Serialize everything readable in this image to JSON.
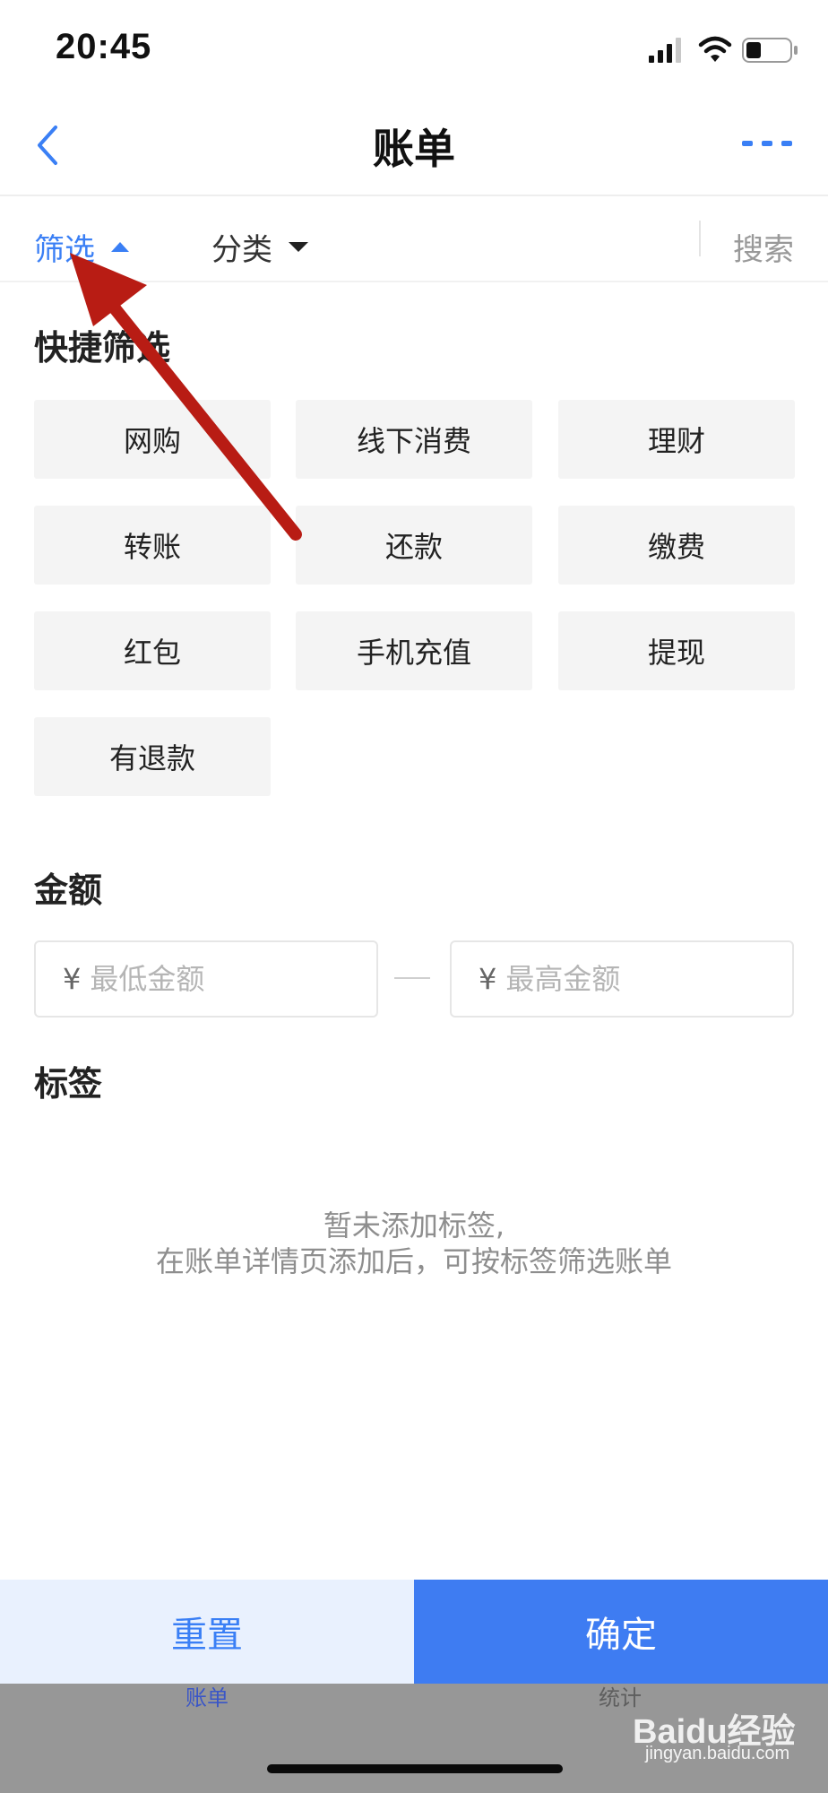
{
  "status_bar": {
    "time": "20:45",
    "icons": [
      "signal-icon",
      "wifi-icon",
      "battery-icon"
    ]
  },
  "nav": {
    "title": "账单",
    "back_icon": "chevron-left-icon",
    "more_icon": "more-dots-icon"
  },
  "filter_bar": {
    "filter_label": "筛选",
    "category_label": "分类",
    "search_label": "搜索"
  },
  "quick_filter": {
    "title": "快捷筛选",
    "chips": [
      "网购",
      "线下消费",
      "理财",
      "转账",
      "还款",
      "缴费",
      "红包",
      "手机充值",
      "提现",
      "有退款"
    ]
  },
  "amount": {
    "title": "金额",
    "currency": "¥",
    "min_placeholder": "最低金额",
    "max_placeholder": "最高金额"
  },
  "tags": {
    "title": "标签",
    "empty_line1": "暂未添加标签,",
    "empty_line2": "在账单详情页添加后，可按标签筛选账单"
  },
  "actions": {
    "reset": "重置",
    "confirm": "确定"
  },
  "tab_bar": {
    "bill": "账单",
    "stats": "统计"
  },
  "watermark": {
    "logo": "Baidu经验",
    "url": "jingyan.baidu.com"
  },
  "colors": {
    "accent": "#3a7ff5",
    "confirm_bg": "#3e7cf2",
    "reset_bg": "#e9f1fe",
    "chip_bg": "#f4f4f4",
    "annotation_arrow": "#b81c14"
  }
}
